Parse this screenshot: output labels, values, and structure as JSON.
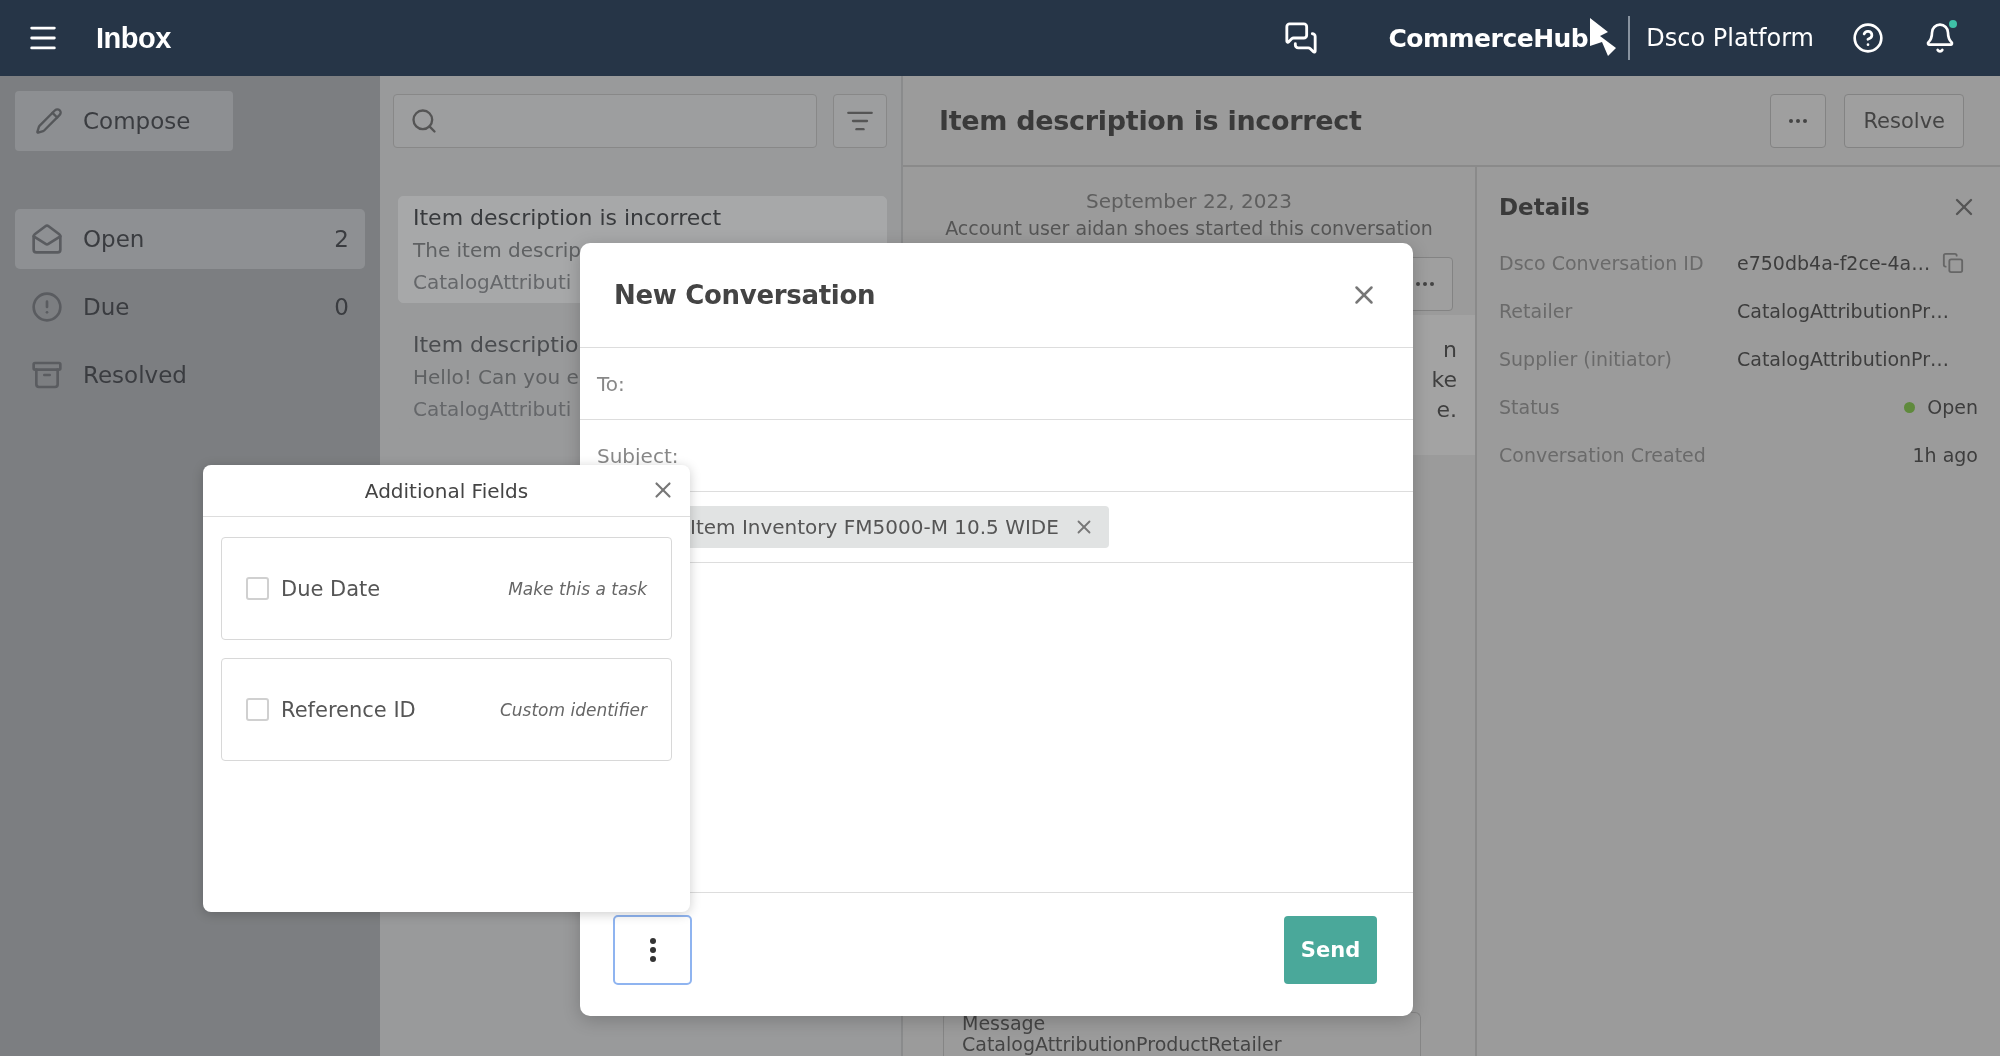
{
  "header": {
    "title": "Inbox",
    "brand": "CommerceHub",
    "product": "Dsco Platform"
  },
  "sidebar": {
    "compose": "Compose",
    "items": [
      {
        "kind": "open",
        "label": "Open",
        "count": "2",
        "selected": true
      },
      {
        "kind": "due",
        "label": "Due",
        "count": "0",
        "selected": false
      },
      {
        "kind": "resolved",
        "label": "Resolved",
        "selected": false
      }
    ]
  },
  "list": {
    "items": [
      {
        "title": "Item description is incorrect",
        "preview": "The item descrip",
        "retailer": "CatalogAttributi",
        "selected": true
      },
      {
        "title": "Item descriptio",
        "preview": "Hello! Can you e",
        "retailer": "CatalogAttributi",
        "selected": false
      }
    ]
  },
  "conversation": {
    "title": "Item description is incorrect",
    "resolve": "Resolve",
    "date": "September 22, 2023",
    "event": "Account user aidan shoes started this conversation",
    "fragments": [
      "n",
      "ke",
      "e."
    ],
    "message_label": "Message",
    "message_sender": "CatalogAttributionProductRetailer"
  },
  "details": {
    "title": "Details",
    "rows": [
      {
        "kind": "copy",
        "label": "Dsco Conversation ID",
        "value": "e750db4a-f2ce-4a…"
      },
      {
        "kind": "text",
        "label": "Retailer",
        "value": "CatalogAttributionPr…"
      },
      {
        "kind": "text",
        "label": "Supplier (initiator)",
        "value": "CatalogAttributionPr…"
      },
      {
        "kind": "status",
        "label": "Status",
        "value": "Open",
        "color": "#5f8a3c"
      },
      {
        "kind": "text",
        "label": "Conversation Created",
        "value": "1h ago"
      }
    ]
  },
  "modal": {
    "title": "New Conversation",
    "fields": [
      {
        "label": "To:"
      },
      {
        "label": "Subject:"
      }
    ],
    "chip": "Item Inventory FM5000-M 10.5 WIDE",
    "send": "Send"
  },
  "popover": {
    "title": "Additional Fields",
    "options": [
      {
        "label": "Due Date",
        "hint": "Make this a task",
        "checked": false
      },
      {
        "label": "Reference ID",
        "hint": "Custom identifier",
        "checked": false
      }
    ]
  }
}
